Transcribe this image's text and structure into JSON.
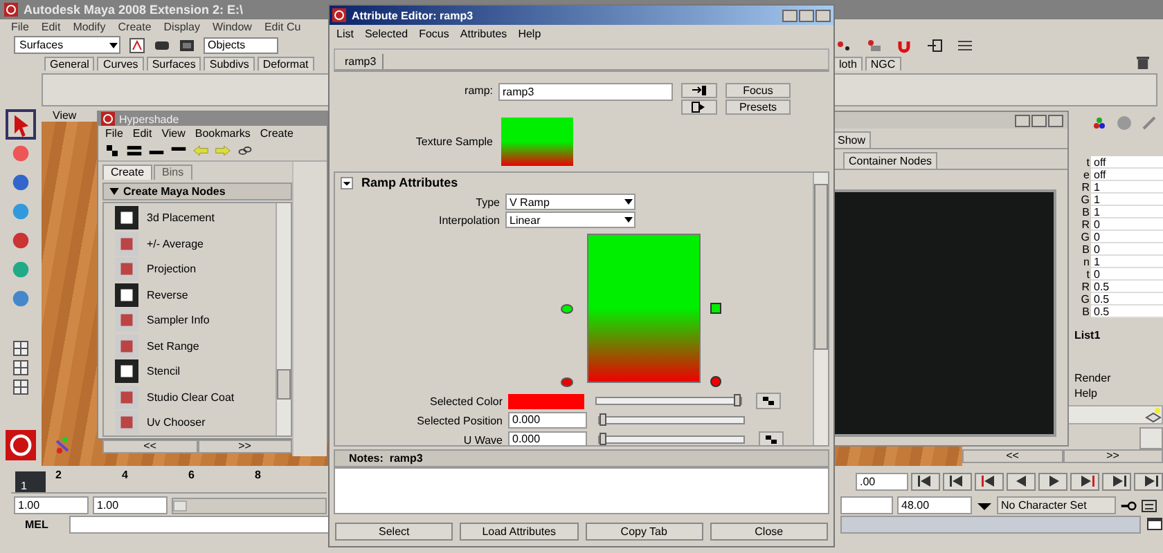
{
  "main": {
    "title": "Autodesk Maya 2008 Extension 2: E:\\",
    "menu": [
      "File",
      "Edit",
      "Modify",
      "Create",
      "Display",
      "Window",
      "Edit Cu"
    ],
    "shelf_set": "Surfaces",
    "selection_mode": "Objects",
    "shelf_tabs": [
      "General",
      "Curves",
      "Surfaces",
      "Subdivs",
      "Deformat"
    ],
    "shelf_tabs_right": [
      "loth",
      "NGC"
    ],
    "panel_menu": [
      "View"
    ]
  },
  "channel_box": {
    "channels": [
      {
        "label": "t",
        "value": "off"
      },
      {
        "label": "e",
        "value": "off"
      },
      {
        "label": "R",
        "value": "1"
      },
      {
        "label": "G",
        "value": "1"
      },
      {
        "label": "B",
        "value": "1"
      },
      {
        "label": "R",
        "value": "0"
      },
      {
        "label": "G",
        "value": "0"
      },
      {
        "label": "B",
        "value": "0"
      },
      {
        "label": "n",
        "value": "1"
      },
      {
        "label": "t",
        "value": "0"
      },
      {
        "label": "R",
        "value": "0.5"
      },
      {
        "label": "G",
        "value": "0.5"
      },
      {
        "label": "B",
        "value": "0.5"
      }
    ],
    "layer": "List1",
    "menu": [
      "Render",
      "Help"
    ],
    "nav": [
      "<<",
      ">>"
    ]
  },
  "panel_window": {
    "tab": "Show",
    "subtab": "Container Nodes"
  },
  "hypershade": {
    "title": "Hypershade",
    "menu": [
      "File",
      "Edit",
      "View",
      "Bookmarks",
      "Create"
    ],
    "tabs": [
      {
        "label": "Create",
        "selected": true
      },
      {
        "label": "Bins",
        "selected": false
      }
    ],
    "section": "Create Maya Nodes",
    "nodes": [
      "3d Placement",
      "+/- Average",
      "Projection",
      "Reverse",
      "Sampler Info",
      "Set Range",
      "Stencil",
      "Studio Clear Coat",
      "Uv Chooser"
    ],
    "nav": [
      "<<",
      ">>"
    ]
  },
  "attribute_editor": {
    "title": "Attribute Editor: ramp3",
    "menu": [
      "List",
      "Selected",
      "Focus",
      "Attributes",
      "Help"
    ],
    "tab": {
      "label": "ramp3",
      "selected": true
    },
    "node_label": "ramp:",
    "node_value": "ramp3",
    "buttons": [
      "Focus",
      "Presets"
    ],
    "texture_label": "Texture Sample",
    "section": "Ramp Attributes",
    "options": [
      {
        "label": "Type",
        "value": "V Ramp"
      },
      {
        "label": "Interpolation",
        "value": "Linear"
      }
    ],
    "ramp": {
      "handles": [
        {
          "color": "#00ee00",
          "level": 0.5,
          "selected": false
        },
        {
          "color": "#ee0000",
          "level": 0,
          "selected": true
        }
      ]
    },
    "attributes": [
      {
        "kind": "color",
        "label": "Selected Color",
        "color": "#ff0000",
        "level": 1,
        "map": true
      },
      {
        "kind": "number",
        "label": "Selected Position",
        "value": "0.000",
        "level": 0,
        "map": false
      },
      {
        "kind": "number",
        "label": "U Wave",
        "value": "0.000",
        "level": 0,
        "map": true
      }
    ],
    "notes": "Notes:  ramp3",
    "actions": [
      "Select",
      "Load Attributes",
      "Copy Tab",
      "Close"
    ]
  },
  "timeline": {
    "ticks": [
      "2",
      "4",
      "6",
      "8"
    ],
    "current_frame": "1",
    "time_slider": {
      "level": 0
    },
    "range_slider": {
      "level": 0
    },
    "current_time": ".00",
    "start": "1.00",
    "range_start": "1.00",
    "range_end": "48.00",
    "character_set": "No Character Set"
  },
  "command_line": {
    "label": "MEL"
  }
}
